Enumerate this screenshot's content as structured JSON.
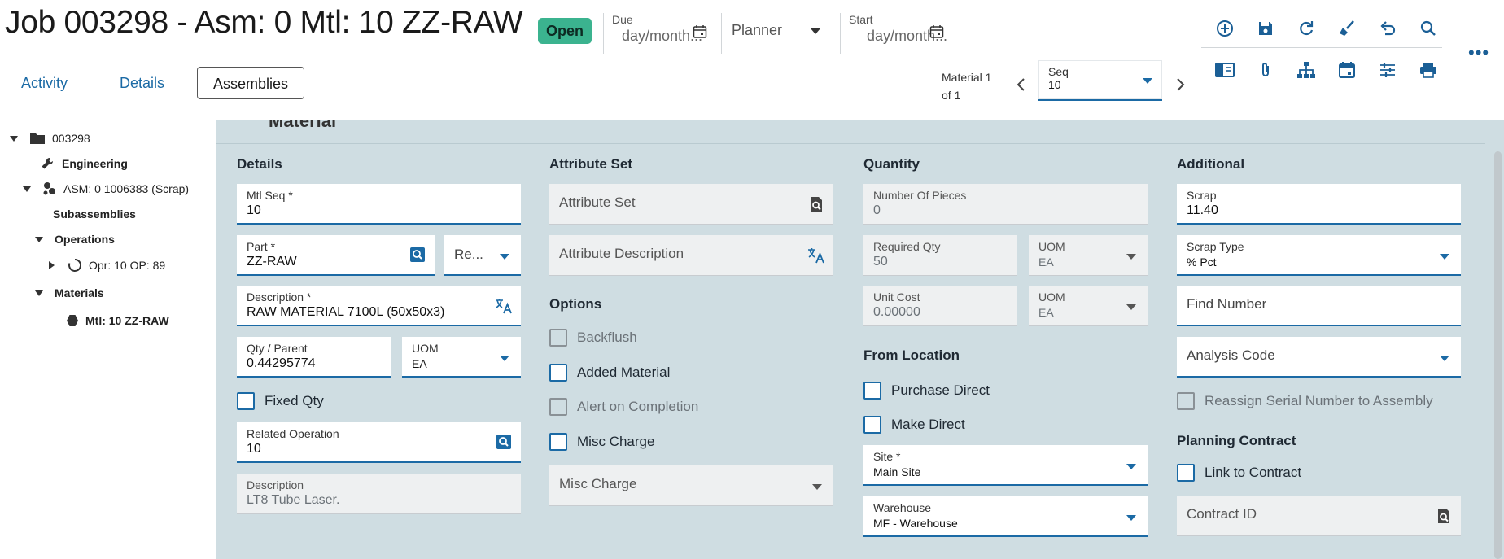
{
  "header": {
    "title": "Job 003298 - Asm: 0 Mtl: 10 ZZ-RAW",
    "status": "Open",
    "due": {
      "label": "Due",
      "placeholder": "day/month..."
    },
    "planner": {
      "placeholder": "Planner"
    },
    "start": {
      "label": "Start",
      "placeholder": "day/month..."
    }
  },
  "tabs": [
    {
      "label": "Activity"
    },
    {
      "label": "Details"
    },
    {
      "label": "Assemblies"
    }
  ],
  "material_nav": {
    "line1": "Material 1",
    "line2": "of 1",
    "seq_label": "Seq",
    "seq_value": "10"
  },
  "toolbar": {
    "row1": [
      "add-icon",
      "save-icon",
      "refresh-icon",
      "clear-icon",
      "undo-icon",
      "search-icon"
    ],
    "row2": [
      "panel-icon",
      "attachment-icon",
      "hierarchy-icon",
      "calendar-icon",
      "tracker-icon",
      "print-icon"
    ]
  },
  "tree": {
    "job": "003298",
    "engineering": "Engineering",
    "assembly": "ASM: 0 1006383 (Scrap)",
    "subassemblies": "Subassemblies",
    "operations": "Operations",
    "operation": "Opr: 10 OP: 89",
    "materials": "Materials",
    "material": "Mtl: 10 ZZ-RAW"
  },
  "section": {
    "title": "Material"
  },
  "details": {
    "title": "Details",
    "mtl_seq": {
      "label": "Mtl Seq *",
      "value": "10"
    },
    "part": {
      "label": "Part *",
      "value": "ZZ-RAW"
    },
    "revision": {
      "placeholder": "Re..."
    },
    "description": {
      "label": "Description *",
      "value": "RAW MATERIAL 7100L (50x50x3)"
    },
    "qty_parent": {
      "label": "Qty / Parent",
      "value": "0.44295774"
    },
    "uom": {
      "label": "UOM",
      "value": "EA"
    },
    "fixed_qty": "Fixed Qty",
    "related_operation": {
      "label": "Related Operation",
      "value": "10"
    },
    "op_description": {
      "label": "Description",
      "value": "LT8 Tube Laser."
    }
  },
  "attribute_set": {
    "title": "Attribute Set",
    "attribute_set": {
      "placeholder": "Attribute Set"
    },
    "attribute_description": {
      "placeholder": "Attribute Description"
    }
  },
  "options": {
    "title": "Options",
    "backflush": "Backflush",
    "added_material": "Added Material",
    "alert_on_completion": "Alert on Completion",
    "misc_charge_chk": "Misc Charge",
    "misc_charge": {
      "placeholder": "Misc Charge"
    }
  },
  "quantity": {
    "title": "Quantity",
    "number_of_pieces": {
      "label": "Number Of Pieces",
      "value": "0"
    },
    "required_qty": {
      "label": "Required Qty",
      "value": "50"
    },
    "req_uom": {
      "label": "UOM",
      "value": "EA"
    },
    "unit_cost": {
      "label": "Unit Cost",
      "value": "0.00000"
    },
    "cost_uom": {
      "label": "UOM",
      "value": "EA"
    }
  },
  "from_location": {
    "title": "From Location",
    "purchase_direct": "Purchase Direct",
    "make_direct": "Make Direct",
    "site": {
      "label": "Site *",
      "value": "Main Site"
    },
    "warehouse": {
      "label": "Warehouse",
      "value": "MF - Warehouse"
    }
  },
  "additional": {
    "title": "Additional",
    "scrap": {
      "label": "Scrap",
      "value": "11.40"
    },
    "scrap_type": {
      "label": "Scrap Type",
      "value": "% Pct"
    },
    "find_number": {
      "placeholder": "Find Number"
    },
    "analysis_code": {
      "placeholder": "Analysis Code"
    },
    "reassign_serial": "Reassign Serial Number to Assembly"
  },
  "planning_contract": {
    "title": "Planning Contract",
    "link_to_contract": "Link to Contract",
    "contract_id": {
      "placeholder": "Contract ID"
    }
  },
  "colors": {
    "accent": "#1b6aa5",
    "status_open": "#3bb38f",
    "panel": "#cfdde2"
  }
}
